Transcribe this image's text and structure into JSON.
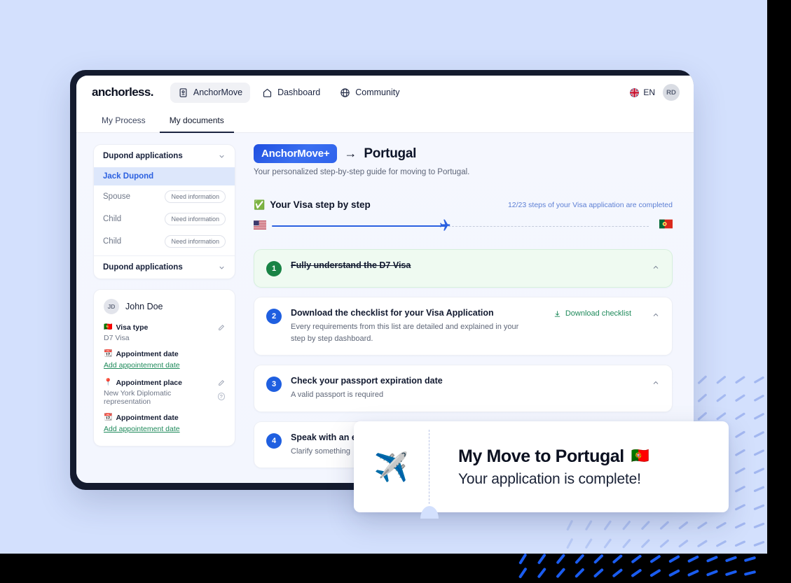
{
  "topnav": {
    "brand": "anchorless.",
    "items": [
      {
        "label": "AnchorMove",
        "icon": "passport-icon",
        "active": true
      },
      {
        "label": "Dashboard",
        "icon": "home-icon",
        "active": false
      },
      {
        "label": "Community",
        "icon": "globe-icon",
        "active": false
      }
    ],
    "language": "EN",
    "language_flag": "uk-flag-icon",
    "avatar_initials": "RD"
  },
  "tabs": [
    {
      "label": "My Process",
      "active": false
    },
    {
      "label": "My documents",
      "active": true
    }
  ],
  "sidebar": {
    "applications_group_1": {
      "title": "Dupond applications",
      "people": [
        {
          "name": "Jack Dupond",
          "status": "",
          "selected": true
        },
        {
          "name": "Spouse",
          "status": "Need information",
          "selected": false
        },
        {
          "name": "Child",
          "status": "Need information",
          "selected": false
        },
        {
          "name": "Child",
          "status": "Need information",
          "selected": false
        }
      ]
    },
    "applications_group_2": {
      "title": "Dupond applications"
    },
    "profile": {
      "initials": "JD",
      "name": "John Doe",
      "fields": [
        {
          "emoji": "🇵🇹",
          "label": "Visa type",
          "value": "D7 Visa",
          "link": "",
          "edit": true,
          "help": false
        },
        {
          "emoji": "📆",
          "label": "Appointment date",
          "value": "",
          "link": "Add appointement date",
          "edit": false,
          "help": false
        },
        {
          "emoji": "📍",
          "label": "Appointment place",
          "value": "New York Diplomatic representation",
          "link": "",
          "edit": true,
          "help": true
        },
        {
          "emoji": "📆",
          "label": "Appointment date",
          "value": "",
          "link": "Add appointement date",
          "edit": false,
          "help": false
        }
      ]
    }
  },
  "main": {
    "badge": "AnchorMove+",
    "arrow": "→",
    "destination": "Portugal",
    "subtitle": "Your personalized step-by-step guide for moving to Portugal.",
    "visa_section_title": "Your Visa step by step",
    "visa_section_emoji": "✅",
    "progress_text": "12/23 steps of your Visa application are completed",
    "progress": {
      "completed": 12,
      "total": 23,
      "percent": 52,
      "from_flag": "us-flag-icon",
      "to_flag": "portugal-flag-icon"
    },
    "steps": [
      {
        "number": "1",
        "title": "Fully understand the D7 Visa",
        "description": "",
        "action": "",
        "done": true
      },
      {
        "number": "2",
        "title": "Download the checklist for your Visa Application",
        "description": "Every requirements from this list are detailed and explained in your step by step dashboard.",
        "action": "Download checklist",
        "done": false
      },
      {
        "number": "3",
        "title": "Check your passport expiration date",
        "description": "A valid passport is required",
        "action": "",
        "done": false
      },
      {
        "number": "4",
        "title": "Speak with an expert",
        "description": "Clarify something",
        "action": "",
        "done": false
      }
    ]
  },
  "overlay": {
    "icon": "✈️",
    "title": "My Move to Portugal",
    "title_emoji": "🇵🇹",
    "subtitle": "Your application is complete!"
  },
  "colors": {
    "backdrop": "#d3e0fd",
    "bezel": "#141b2e",
    "accent_blue": "#2b60e0",
    "accent_green": "#1f8a5b",
    "done_bg": "#effaf1"
  }
}
